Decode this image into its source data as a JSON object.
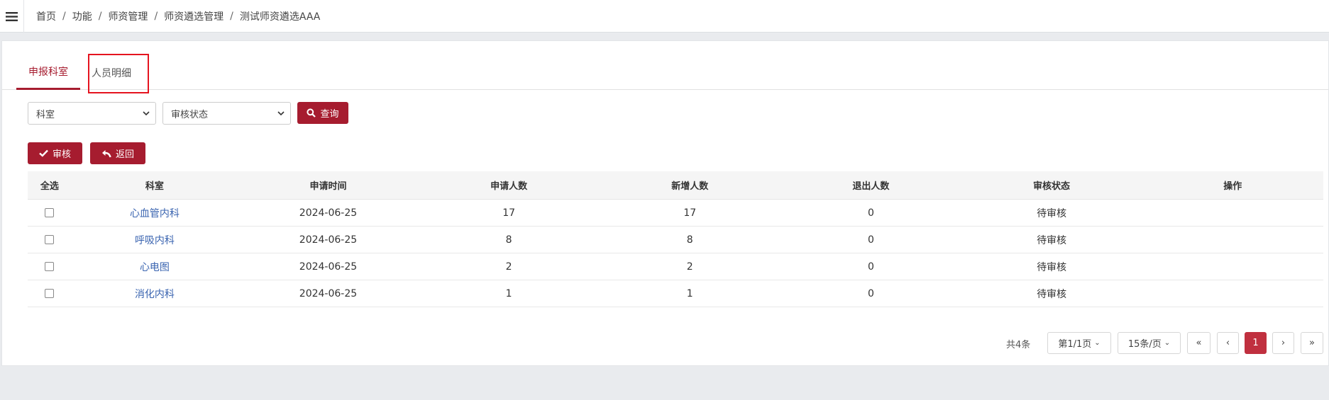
{
  "breadcrumb": [
    "首页",
    "功能",
    "师资管理",
    "师资遴选管理",
    "测试师资遴选AAA"
  ],
  "tabs": {
    "active": "申报科室",
    "second": "人员明细"
  },
  "filters": {
    "dept_placeholder": "科室",
    "status_placeholder": "审核状态",
    "query_label": "查询"
  },
  "actions": {
    "audit_label": "审核",
    "back_label": "返回"
  },
  "table": {
    "headers": [
      "全选",
      "科室",
      "申请时间",
      "申请人数",
      "新增人数",
      "退出人数",
      "审核状态",
      "操作"
    ],
    "rows": [
      {
        "dept": "心血管内科",
        "date": "2024-06-25",
        "applied": "17",
        "added": "17",
        "exited": "0",
        "status": "待审核"
      },
      {
        "dept": "呼吸内科",
        "date": "2024-06-25",
        "applied": "8",
        "added": "8",
        "exited": "0",
        "status": "待审核"
      },
      {
        "dept": "心电图",
        "date": "2024-06-25",
        "applied": "2",
        "added": "2",
        "exited": "0",
        "status": "待审核"
      },
      {
        "dept": "消化内科",
        "date": "2024-06-25",
        "applied": "1",
        "added": "1",
        "exited": "0",
        "status": "待审核"
      }
    ]
  },
  "pagination": {
    "total": "共4条",
    "page_info": "第1/1页",
    "page_size": "15条/页",
    "current": "1",
    "first": "«",
    "prev": "‹",
    "next": "›",
    "last": "»"
  },
  "colors": {
    "accent": "#a61c2f",
    "link": "#3a64b0",
    "highlight": "#e5141f"
  }
}
